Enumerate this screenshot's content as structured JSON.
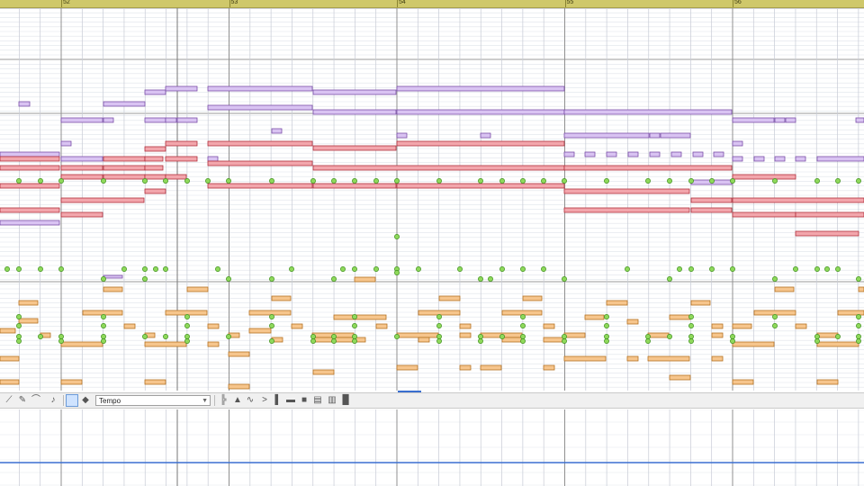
{
  "ruler": {
    "bars": [
      {
        "label": "52",
        "tick": 36
      },
      {
        "label": "53",
        "tick": 40
      },
      {
        "label": "54",
        "tick": 44
      },
      {
        "label": "55",
        "tick": 48
      },
      {
        "label": "56",
        "tick": 52
      }
    ]
  },
  "toolbar": {
    "mode_value": "Tempo",
    "buttons": [
      {
        "name": "line-tool-icon",
        "glyph": "⟋"
      },
      {
        "name": "freehand-tool-icon",
        "glyph": "✎"
      },
      {
        "name": "parabola-tool-icon",
        "glyph": "⌒"
      },
      {
        "name": "velocity-tool-icon",
        "glyph": "♪"
      },
      {
        "name": "select-tool-icon",
        "glyph": "",
        "active": true
      },
      {
        "name": "erase-tool-icon",
        "glyph": "◆"
      }
    ],
    "right_buttons": [
      {
        "name": "bars-view-icon",
        "glyph": "╠"
      },
      {
        "name": "weight-icon",
        "glyph": "▲"
      },
      {
        "name": "curve-view-icon",
        "glyph": "∿"
      },
      {
        "name": "greater-than-icon",
        "glyph": ">"
      },
      {
        "name": "slim-bar-icon",
        "glyph": "▌"
      },
      {
        "name": "stretch-icon",
        "glyph": "▬"
      },
      {
        "name": "lock-icon",
        "glyph": "■"
      },
      {
        "name": "grid-box-icon",
        "glyph": "▤"
      },
      {
        "name": "grid-box-2-icon",
        "glyph": "▥"
      },
      {
        "name": "solid-bar-icon",
        "glyph": "█"
      }
    ]
  },
  "colors": {
    "purple_note": "#d9c3f2",
    "purple_edge": "#7a4fa8",
    "red_note": "#f2a6ac",
    "red_edge": "#b0303c",
    "orange_note": "#f6c58c",
    "orange_edge": "#b57222",
    "marker": "#8fd95b",
    "marker_edge": "#3d8f1c",
    "grid_line": "#dfe3ea",
    "beat_line": "#c7cbd5",
    "bar_line": "#909090",
    "ctrl_line": "#3a6fd0"
  },
  "notes": {
    "purple": [
      [
        21,
        113,
        12,
        5
      ],
      [
        115,
        113,
        46,
        5
      ],
      [
        161,
        100,
        23,
        5
      ],
      [
        184,
        96,
        35,
        5
      ],
      [
        231,
        96,
        116,
        5
      ],
      [
        348,
        100,
        92,
        5
      ],
      [
        441,
        96,
        186,
        5
      ],
      [
        231,
        117,
        116,
        5
      ],
      [
        348,
        122,
        92,
        5
      ],
      [
        441,
        122,
        186,
        5
      ],
      [
        627,
        122,
        186,
        5
      ],
      [
        68,
        131,
        46,
        5
      ],
      [
        115,
        131,
        11,
        5
      ],
      [
        161,
        131,
        23,
        5
      ],
      [
        184,
        131,
        12,
        5
      ],
      [
        197,
        131,
        22,
        5
      ],
      [
        814,
        131,
        46,
        5
      ],
      [
        861,
        131,
        11,
        5
      ],
      [
        873,
        131,
        11,
        5
      ],
      [
        951,
        131,
        9,
        5
      ],
      [
        302,
        143,
        11,
        5
      ],
      [
        441,
        148,
        11,
        5
      ],
      [
        534,
        148,
        11,
        5
      ],
      [
        627,
        148,
        94,
        5
      ],
      [
        722,
        148,
        11,
        5
      ],
      [
        734,
        148,
        33,
        5
      ],
      [
        68,
        157,
        11,
        5
      ],
      [
        814,
        157,
        11,
        5
      ],
      [
        0,
        169,
        66,
        5
      ],
      [
        627,
        169,
        11,
        5
      ],
      [
        650,
        169,
        11,
        5
      ],
      [
        674,
        169,
        11,
        5
      ],
      [
        698,
        169,
        11,
        5
      ],
      [
        722,
        169,
        11,
        5
      ],
      [
        746,
        169,
        11,
        5
      ],
      [
        770,
        169,
        11,
        5
      ],
      [
        793,
        169,
        11,
        5
      ],
      [
        814,
        174,
        11,
        5
      ],
      [
        838,
        174,
        11,
        5
      ],
      [
        861,
        174,
        11,
        5
      ],
      [
        884,
        174,
        11,
        5
      ],
      [
        908,
        174,
        52,
        5
      ],
      [
        68,
        174,
        46,
        5
      ],
      [
        231,
        174,
        11,
        5
      ],
      [
        0,
        245,
        66,
        5
      ],
      [
        768,
        200,
        45,
        5
      ],
      [
        115,
        306,
        21,
        3
      ]
    ],
    "red": [
      [
        161,
        163,
        23,
        5
      ],
      [
        184,
        157,
        35,
        5
      ],
      [
        231,
        157,
        116,
        5
      ],
      [
        348,
        162,
        92,
        5
      ],
      [
        441,
        157,
        186,
        5
      ],
      [
        0,
        174,
        66,
        5
      ],
      [
        115,
        174,
        46,
        5
      ],
      [
        161,
        174,
        20,
        5
      ],
      [
        184,
        174,
        35,
        5
      ],
      [
        231,
        179,
        116,
        5
      ],
      [
        0,
        184,
        66,
        5
      ],
      [
        68,
        184,
        46,
        5
      ],
      [
        115,
        184,
        46,
        5
      ],
      [
        161,
        184,
        20,
        5
      ],
      [
        348,
        184,
        279,
        5
      ],
      [
        627,
        184,
        186,
        5
      ],
      [
        68,
        194,
        46,
        5
      ],
      [
        115,
        194,
        46,
        5
      ],
      [
        161,
        194,
        23,
        5
      ],
      [
        184,
        194,
        23,
        5
      ],
      [
        814,
        194,
        70,
        5
      ],
      [
        0,
        204,
        66,
        5
      ],
      [
        231,
        204,
        116,
        5
      ],
      [
        348,
        204,
        92,
        5
      ],
      [
        441,
        204,
        186,
        5
      ],
      [
        161,
        210,
        23,
        5
      ],
      [
        627,
        210,
        139,
        5
      ],
      [
        68,
        220,
        92,
        5
      ],
      [
        768,
        220,
        45,
        5
      ],
      [
        814,
        220,
        146,
        5
      ],
      [
        0,
        231,
        66,
        5
      ],
      [
        627,
        231,
        139,
        5
      ],
      [
        768,
        231,
        45,
        5
      ],
      [
        68,
        236,
        46,
        5
      ],
      [
        814,
        236,
        70,
        5
      ],
      [
        884,
        236,
        76,
        5
      ],
      [
        884,
        257,
        70,
        5
      ]
    ],
    "orange": [
      [
        21,
        334,
        21,
        5
      ],
      [
        115,
        319,
        21,
        5
      ],
      [
        208,
        319,
        23,
        5
      ],
      [
        302,
        329,
        21,
        5
      ],
      [
        394,
        308,
        23,
        5
      ],
      [
        488,
        329,
        23,
        5
      ],
      [
        581,
        329,
        21,
        5
      ],
      [
        674,
        334,
        23,
        5
      ],
      [
        768,
        334,
        21,
        5
      ],
      [
        861,
        319,
        21,
        5
      ],
      [
        954,
        319,
        6,
        5
      ],
      [
        92,
        345,
        44,
        5
      ],
      [
        184,
        345,
        46,
        5
      ],
      [
        277,
        345,
        46,
        5
      ],
      [
        371,
        350,
        58,
        5
      ],
      [
        465,
        345,
        46,
        5
      ],
      [
        558,
        345,
        44,
        5
      ],
      [
        650,
        350,
        21,
        5
      ],
      [
        744,
        350,
        23,
        5
      ],
      [
        838,
        345,
        46,
        5
      ],
      [
        931,
        345,
        29,
        5
      ],
      [
        21,
        354,
        21,
        5
      ],
      [
        138,
        360,
        12,
        5
      ],
      [
        231,
        360,
        12,
        5
      ],
      [
        324,
        360,
        12,
        5
      ],
      [
        418,
        360,
        12,
        5
      ],
      [
        511,
        360,
        12,
        5
      ],
      [
        604,
        360,
        12,
        5
      ],
      [
        697,
        355,
        12,
        5
      ],
      [
        791,
        360,
        12,
        5
      ],
      [
        884,
        360,
        12,
        5
      ],
      [
        0,
        365,
        17,
        5
      ],
      [
        277,
        365,
        24,
        5
      ],
      [
        814,
        360,
        21,
        5
      ],
      [
        45,
        370,
        11,
        5
      ],
      [
        161,
        370,
        11,
        5
      ],
      [
        254,
        370,
        12,
        5
      ],
      [
        347,
        370,
        46,
        5
      ],
      [
        441,
        370,
        46,
        5
      ],
      [
        511,
        370,
        12,
        5
      ],
      [
        534,
        370,
        46,
        5
      ],
      [
        627,
        370,
        23,
        5
      ],
      [
        720,
        370,
        23,
        5
      ],
      [
        791,
        370,
        12,
        5
      ],
      [
        908,
        370,
        23,
        5
      ],
      [
        68,
        380,
        46,
        5
      ],
      [
        161,
        380,
        46,
        5
      ],
      [
        231,
        380,
        12,
        5
      ],
      [
        302,
        375,
        12,
        5
      ],
      [
        348,
        375,
        46,
        5
      ],
      [
        394,
        375,
        12,
        5
      ],
      [
        465,
        375,
        12,
        5
      ],
      [
        558,
        375,
        23,
        5
      ],
      [
        604,
        375,
        23,
        5
      ],
      [
        814,
        380,
        46,
        5
      ],
      [
        908,
        380,
        46,
        5
      ],
      [
        254,
        391,
        23,
        5
      ],
      [
        627,
        396,
        46,
        5
      ],
      [
        697,
        396,
        12,
        5
      ],
      [
        720,
        396,
        46,
        5
      ],
      [
        791,
        396,
        12,
        5
      ],
      [
        0,
        396,
        21,
        5
      ],
      [
        441,
        406,
        23,
        5
      ],
      [
        511,
        406,
        12,
        5
      ],
      [
        534,
        406,
        23,
        5
      ],
      [
        604,
        406,
        12,
        5
      ],
      [
        348,
        411,
        23,
        5
      ],
      [
        0,
        422,
        21,
        5
      ],
      [
        68,
        422,
        23,
        5
      ],
      [
        161,
        422,
        23,
        5
      ],
      [
        744,
        417,
        23,
        5
      ],
      [
        814,
        422,
        23,
        5
      ],
      [
        908,
        422,
        23,
        5
      ],
      [
        254,
        427,
        23,
        5
      ]
    ]
  },
  "markers": [
    [
      21,
      201
    ],
    [
      45,
      201
    ],
    [
      68,
      201
    ],
    [
      115,
      201
    ],
    [
      161,
      201
    ],
    [
      184,
      201
    ],
    [
      208,
      201
    ],
    [
      231,
      201
    ],
    [
      254,
      201
    ],
    [
      302,
      201
    ],
    [
      348,
      201
    ],
    [
      371,
      201
    ],
    [
      394,
      201
    ],
    [
      418,
      201
    ],
    [
      441,
      201
    ],
    [
      488,
      201
    ],
    [
      534,
      201
    ],
    [
      558,
      201
    ],
    [
      581,
      201
    ],
    [
      604,
      201
    ],
    [
      627,
      201
    ],
    [
      674,
      201
    ],
    [
      720,
      201
    ],
    [
      744,
      201
    ],
    [
      768,
      201
    ],
    [
      791,
      201
    ],
    [
      814,
      201
    ],
    [
      861,
      201
    ],
    [
      908,
      201
    ],
    [
      931,
      201
    ],
    [
      954,
      201
    ],
    [
      441,
      263
    ],
    [
      8,
      299
    ],
    [
      21,
      299
    ],
    [
      45,
      299
    ],
    [
      68,
      299
    ],
    [
      138,
      299
    ],
    [
      161,
      299
    ],
    [
      173,
      299
    ],
    [
      184,
      299
    ],
    [
      242,
      299
    ],
    [
      324,
      299
    ],
    [
      381,
      299
    ],
    [
      394,
      299
    ],
    [
      418,
      299
    ],
    [
      441,
      299
    ],
    [
      465,
      299
    ],
    [
      511,
      299
    ],
    [
      558,
      299
    ],
    [
      581,
      299
    ],
    [
      604,
      299
    ],
    [
      697,
      299
    ],
    [
      755,
      299
    ],
    [
      768,
      299
    ],
    [
      791,
      299
    ],
    [
      814,
      299
    ],
    [
      884,
      299
    ],
    [
      908,
      299
    ],
    [
      919,
      299
    ],
    [
      931,
      299
    ],
    [
      115,
      310
    ],
    [
      161,
      310
    ],
    [
      254,
      310
    ],
    [
      302,
      310
    ],
    [
      371,
      310
    ],
    [
      441,
      303
    ],
    [
      534,
      310
    ],
    [
      545,
      310
    ],
    [
      627,
      310
    ],
    [
      744,
      310
    ],
    [
      861,
      310
    ],
    [
      954,
      310
    ],
    [
      21,
      352
    ],
    [
      115,
      352
    ],
    [
      208,
      352
    ],
    [
      302,
      352
    ],
    [
      394,
      352
    ],
    [
      488,
      352
    ],
    [
      581,
      352
    ],
    [
      674,
      352
    ],
    [
      768,
      352
    ],
    [
      861,
      352
    ],
    [
      954,
      352
    ],
    [
      21,
      362
    ],
    [
      115,
      362
    ],
    [
      208,
      362
    ],
    [
      302,
      362
    ],
    [
      394,
      362
    ],
    [
      488,
      362
    ],
    [
      581,
      362
    ],
    [
      674,
      362
    ],
    [
      768,
      362
    ],
    [
      861,
      362
    ],
    [
      954,
      362
    ],
    [
      21,
      374
    ],
    [
      45,
      374
    ],
    [
      68,
      374
    ],
    [
      115,
      374
    ],
    [
      161,
      374
    ],
    [
      184,
      374
    ],
    [
      208,
      374
    ],
    [
      254,
      374
    ],
    [
      348,
      374
    ],
    [
      371,
      374
    ],
    [
      394,
      374
    ],
    [
      441,
      374
    ],
    [
      488,
      374
    ],
    [
      534,
      374
    ],
    [
      558,
      374
    ],
    [
      581,
      374
    ],
    [
      627,
      374
    ],
    [
      674,
      374
    ],
    [
      720,
      374
    ],
    [
      744,
      374
    ],
    [
      768,
      374
    ],
    [
      814,
      374
    ],
    [
      908,
      374
    ],
    [
      931,
      374
    ],
    [
      954,
      374
    ],
    [
      21,
      379
    ],
    [
      68,
      379
    ],
    [
      115,
      379
    ],
    [
      208,
      379
    ],
    [
      302,
      379
    ],
    [
      348,
      379
    ],
    [
      371,
      379
    ],
    [
      394,
      379
    ],
    [
      488,
      379
    ],
    [
      534,
      379
    ],
    [
      581,
      379
    ],
    [
      627,
      379
    ],
    [
      674,
      379
    ],
    [
      720,
      379
    ],
    [
      768,
      379
    ],
    [
      814,
      379
    ],
    [
      908,
      379
    ],
    [
      954,
      379
    ]
  ]
}
